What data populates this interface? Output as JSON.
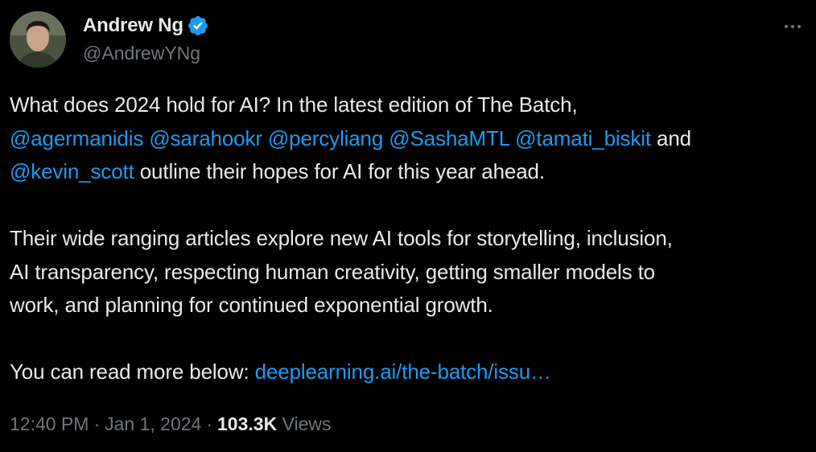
{
  "author": {
    "display_name": "Andrew Ng",
    "handle": "@AndrewYNg",
    "verified": true,
    "verified_color": "#1d9bf0"
  },
  "tweet": {
    "line1": "What does 2024 hold for AI? In the latest edition of The Batch,",
    "mentions": [
      "@agermanidis",
      "@sarahookr",
      "@percyliang",
      "@SashaMTL",
      "@tamati_biskit"
    ],
    "and_word": "and",
    "mention_last": "@kevin_scott",
    "line3_rest": "outline their hopes for AI for this year ahead.",
    "para2_line1": "Their wide ranging articles explore new AI tools for storytelling, inclusion,",
    "para2_line2": "AI transparency, respecting human creativity, getting smaller models to",
    "para2_line3": "work, and planning for continued exponential growth.",
    "para3_prefix": "You can read more below:",
    "link_text": "deeplearning.ai/the-batch/issu…"
  },
  "meta": {
    "time": "12:40 PM",
    "dot": "·",
    "date": "Jan 1, 2024",
    "views_count": "103.3K",
    "views_label": "Views"
  },
  "colors": {
    "background": "#000000",
    "text": "#e7e9ea",
    "secondary": "#71767b",
    "link": "#1d9bf0"
  }
}
